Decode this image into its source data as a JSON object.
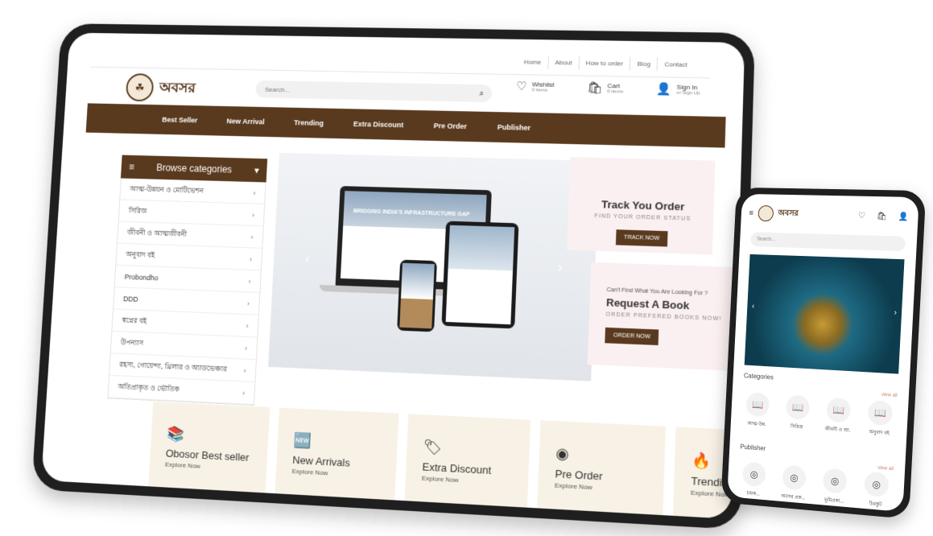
{
  "site": {
    "logo_text": "অবসর"
  },
  "topnav": [
    "Home",
    "About",
    "How to order",
    "Blog",
    "Contact"
  ],
  "search": {
    "placeholder": "Search..."
  },
  "actions": {
    "wishlist": {
      "label": "Wishlist",
      "sub": "0 items"
    },
    "cart": {
      "label": "Cart",
      "sub": "0 items"
    },
    "signin": {
      "label": "Sign In",
      "sub": "or Sign Up"
    }
  },
  "mainnav": [
    "Best Seller",
    "New Arrival",
    "Trending",
    "Extra Discount",
    "Pre Order",
    "Publisher"
  ],
  "categories": {
    "title": "Browse categories",
    "items": [
      "আত্ম-উন্নয়ন ও মোটিভেশন",
      "সিরিজ",
      "জীবনী ও আত্মজীবনী",
      "অনুবাদ বই",
      "Probondho",
      "DDD",
      "স্বপ্নের বই",
      "উপন্যাস",
      "রহস্য, গোয়েন্দা, থ্রিলার ও অ্যাডভেঞ্চার",
      "অতিপ্রাকৃত ও ভৌতিক"
    ]
  },
  "slider": {
    "headline": "BRIDGING INDIA'S INFRASTRUCTURE GAP"
  },
  "promo_track": {
    "title": "Track You Order",
    "sub": "FIND YOUR ORDER STATUS",
    "button": "TRACK NOW"
  },
  "promo_request": {
    "pre": "Can't Find What You Are Looking For ?",
    "title": "Request A Book",
    "sub": "ORDER PREFERED BOOKS NOW!",
    "button": "ORDER NOW"
  },
  "tiles": [
    {
      "title": "Obosor Best seller",
      "explore": "Explore Now",
      "icon": "book-stack-icon"
    },
    {
      "title": "New Arrivals",
      "explore": "Explore Now",
      "icon": "new-badge-icon"
    },
    {
      "title": "Extra Discount",
      "explore": "Explore Now",
      "icon": "price-tag-icon"
    },
    {
      "title": "Pre Order",
      "explore": "Explore Now",
      "icon": "seal-icon"
    },
    {
      "title": "Trending",
      "explore": "Explore Now",
      "icon": "fire-icon"
    }
  ],
  "mobile": {
    "logo_text": "অবসর",
    "search_placeholder": "Search...",
    "categories_title": "Categories",
    "view_all": "view all",
    "categories": [
      "আত্ম-উন্ন.",
      "সিরিজ",
      "জীবনী ও আ.",
      "অনুবাদ বই"
    ],
    "publisher_title": "Publisher",
    "publishers": [
      "চন্দ্রক...",
      "অবসর প্রক...",
      "ভূমিপ্রকা...",
      "চিরকুট"
    ]
  },
  "colors": {
    "brand": "#5a3a1e",
    "tile_bg": "#f8f2e6",
    "promo_bg": "#fbf0f1"
  }
}
